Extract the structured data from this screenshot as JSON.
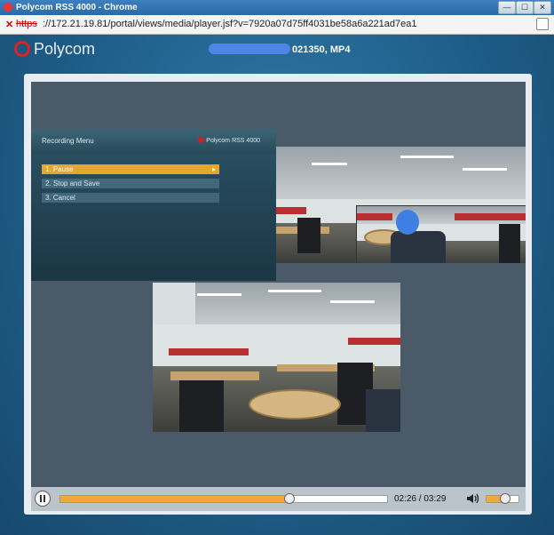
{
  "window": {
    "title": "Polycom RSS 4000 - Chrome",
    "min": "—",
    "max": "☐",
    "close": "✕"
  },
  "address": {
    "lock": "✕",
    "scheme": "https",
    "rest": "://172.21.19.81/portal/views/media/player.jsf?v=7920a07d75ff4031be58a6a221ad7ea1"
  },
  "header": {
    "logo": "Polycom",
    "file_title": "021350, MP4"
  },
  "recording_menu": {
    "title": "Recording Menu",
    "brand": "Polycom RSS 4000",
    "items": [
      {
        "label": "1. Pause",
        "selected": true
      },
      {
        "label": "2. Stop and Save",
        "selected": false
      },
      {
        "label": "3. Cancel",
        "selected": false
      }
    ]
  },
  "controls": {
    "current_time": "02:26",
    "separator": " / ",
    "duration": "03:29",
    "progress_fraction": 0.7,
    "volume_fraction": 0.55
  },
  "colors": {
    "accent": "#f2a93b",
    "background": "#1f5c86",
    "menu_selected": "#e3a72b"
  }
}
